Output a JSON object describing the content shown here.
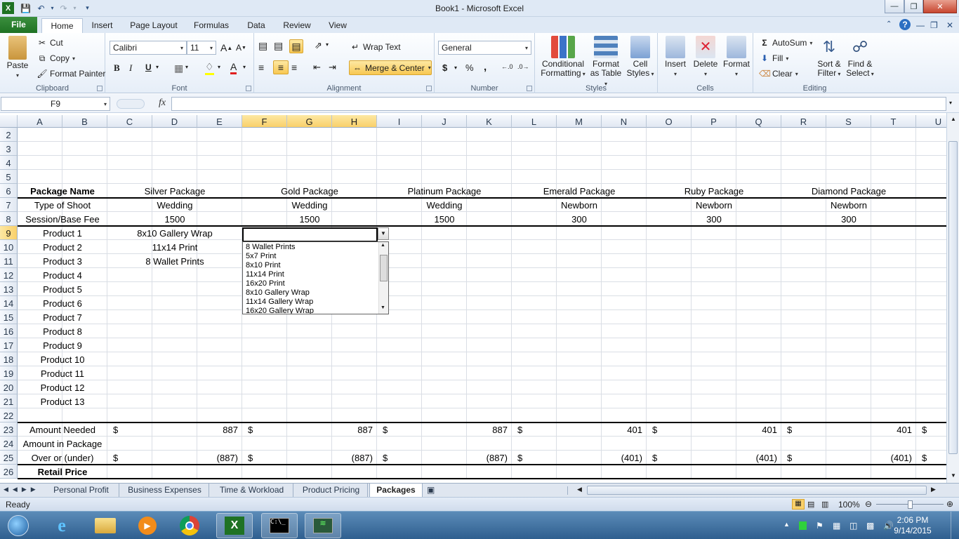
{
  "window": {
    "title": "Book1  -  Microsoft Excel"
  },
  "menu": {
    "file": "File",
    "tabs": [
      "Home",
      "Insert",
      "Page Layout",
      "Formulas",
      "Data",
      "Review",
      "View"
    ]
  },
  "ribbon": {
    "clipboard": {
      "label": "Clipboard",
      "paste": "Paste",
      "cut": "Cut",
      "copy": "Copy",
      "format_painter": "Format Painter"
    },
    "font": {
      "label": "Font",
      "name": "Calibri",
      "size": "11",
      "bold": "B",
      "italic": "I",
      "underline": "U"
    },
    "alignment": {
      "label": "Alignment",
      "wrap": "Wrap Text",
      "merge": "Merge & Center"
    },
    "number": {
      "label": "Number",
      "format": "General",
      "currency": "$",
      "percent": "%",
      "comma": ","
    },
    "styles": {
      "label": "Styles",
      "conditional": "Conditional",
      "conditional2": "Formatting",
      "table": "Format",
      "table2": "as Table",
      "cell": "Cell",
      "cell2": "Styles"
    },
    "cells": {
      "label": "Cells",
      "insert": "Insert",
      "delete": "Delete",
      "format": "Format"
    },
    "editing": {
      "label": "Editing",
      "autosum": "AutoSum",
      "fill": "Fill",
      "clear": "Clear",
      "sort": "Sort &",
      "sort2": "Filter",
      "find": "Find &",
      "find2": "Select"
    }
  },
  "formula_bar": {
    "name_box": "F9",
    "fx": "fx",
    "value": ""
  },
  "columns": [
    "A",
    "B",
    "C",
    "D",
    "E",
    "F",
    "G",
    "H",
    "I",
    "J",
    "K",
    "L",
    "M",
    "N",
    "O",
    "P",
    "Q",
    "R",
    "S",
    "T",
    "U"
  ],
  "rows": [
    "2",
    "3",
    "4",
    "5",
    "6",
    "7",
    "8",
    "9",
    "10",
    "11",
    "12",
    "13",
    "14",
    "15",
    "16",
    "17",
    "18",
    "19",
    "20",
    "21",
    "22",
    "23",
    "24",
    "25",
    "26"
  ],
  "sheet": {
    "package_name_label": "Package Name",
    "packages": [
      "Silver Package",
      "Gold Package",
      "Platinum Package",
      "Emerald Package",
      "Ruby Package",
      "Diamond Package"
    ],
    "type_label": "Type of Shoot",
    "types": [
      "Wedding",
      "Wedding",
      "Wedding",
      "Newborn",
      "Newborn",
      "Newborn"
    ],
    "fee_label": "Session/Base Fee",
    "fees": [
      "1500",
      "1500",
      "1500",
      "300",
      "300",
      "300"
    ],
    "products": [
      "Product 1",
      "Product 2",
      "Product 3",
      "Product 4",
      "Product 5",
      "Product 6",
      "Product 7",
      "Product 8",
      "Product 9",
      "Product 10",
      "Product 11",
      "Product 12",
      "Product 13"
    ],
    "silver_products": [
      "8x10 Gallery Wrap",
      "11x14 Print",
      "8 Wallet Prints"
    ],
    "amount_needed_label": "Amount Needed",
    "amount_needed": [
      "887",
      "887",
      "887",
      "401",
      "401",
      "401"
    ],
    "amount_in_package_label": "Amount in Package",
    "over_under_label": "Over or (under)",
    "over_under": [
      "(887)",
      "(887)",
      "(887)",
      "(401)",
      "(401)",
      "(401)"
    ],
    "retail_label": "Retail Price",
    "currency": "$"
  },
  "dropdown": {
    "items": [
      "8 Wallet Prints",
      "5x7 Print",
      "8x10 Print",
      "11x14 Print",
      "16x20 Print",
      "8x10 Gallery Wrap",
      "11x14 Gallery Wrap",
      "16x20 Gallery Wrap"
    ]
  },
  "sheet_tabs": [
    "Personal Profit",
    "Business Expenses",
    "Time & Workload",
    "Product Pricing",
    "Packages"
  ],
  "status": {
    "ready": "Ready",
    "zoom": "100%"
  },
  "taskbar": {
    "time": "2:06 PM",
    "date": "9/14/2015"
  },
  "colors": {
    "excel_green": "#1f7224",
    "selection": "#f9d06a",
    "ribbon": "#dfe9f5"
  }
}
